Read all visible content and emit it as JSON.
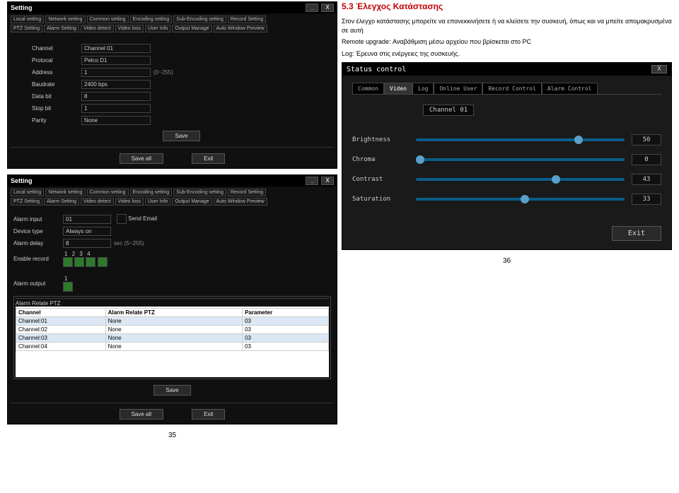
{
  "left": {
    "win1": {
      "title": "Setting",
      "tabs_row1": [
        "Local setting",
        "Network setting",
        "Common setting",
        "Encoding setting",
        "Sub-Encoding setting",
        "Record Setting"
      ],
      "tabs_row2": [
        "PTZ Setting",
        "Alarm Setting",
        "Video detect",
        "Video loss",
        "User Info",
        "Output Manage",
        "Auto Window Preview"
      ],
      "rows": {
        "channel_l": "Channel",
        "channel_v": "Channel 01",
        "protocol_l": "Protocal",
        "protocol_v": "Pelco D1",
        "address_l": "Address",
        "address_v": "1",
        "address_h": "(0~255)",
        "baud_l": "Baudrate",
        "baud_v": "2400 bps",
        "databit_l": "Data bit",
        "databit_v": "8",
        "stopbit_l": "Stop bit",
        "stopbit_v": "1",
        "parity_l": "Parity",
        "parity_v": "None"
      },
      "save": "Save",
      "saveall": "Save all",
      "exit": "Exit"
    },
    "win2": {
      "title": "Setting",
      "tabs_row1": [
        "Local setting",
        "Network setting",
        "Common setting",
        "Encoding setting",
        "Sub-Encoding setting",
        "Record Setting"
      ],
      "tabs_row2": [
        "PTZ Setting",
        "Alarm Setting",
        "Video detect",
        "Video loss",
        "User Info",
        "Output Manage",
        "Auto Window Preview"
      ],
      "alarm_input_l": "Alarm input",
      "alarm_input_v": "01",
      "sendemail": "Send Email",
      "device_type_l": "Device type",
      "device_type_v": "Always on",
      "alarm_delay_l": "Alarm delay",
      "alarm_delay_v": "8",
      "alarm_delay_h": "sec (5~255)",
      "enable_rec_l": "Enable record",
      "squares": [
        "1",
        "2",
        "3",
        "4"
      ],
      "alarm_output_l": "Alarm output",
      "alarm_output_sq": "1",
      "relate_label": "Alarm Relate PTZ",
      "thead": [
        "Channel",
        "Alarm Relate PTZ",
        "Parameter"
      ],
      "trow1": [
        "Channel:01",
        "None",
        "03"
      ],
      "trow2": [
        "Channel:02",
        "None",
        "03"
      ],
      "trow3": [
        "Channel:03",
        "None",
        "03"
      ],
      "trow4": [
        "Channel:04",
        "None",
        "03"
      ],
      "save": "Save",
      "saveall": "Save all",
      "exit": "Exit"
    },
    "page": "35"
  },
  "right": {
    "heading": "5.3 Έλεγχος Κατάστασης",
    "p1": "Στον έλεγχο κατάστασης μπορείτε να επανεκκινήσετε ή να κλείσετε την συσκευή, όπως και να μπείτε απομακρυσμένα σε αυτή",
    "p2": "Remote upgrade: Αναβάθμιση μέσω αρχείου που βρίσκεται στο PC",
    "p3": "Log: Έρευνα στις ενέργειες της συσκευής.",
    "status": {
      "title": "Status control",
      "close": "X",
      "tabs": [
        "Common",
        "Video",
        "Log",
        "Online User",
        "Record Control",
        "Alarm Control"
      ],
      "active": 1,
      "channel": "Channel 01",
      "sliders": [
        {
          "label": "Brightness",
          "val": "50",
          "pct": 76
        },
        {
          "label": "Chroma",
          "val": "0",
          "pct": 0
        },
        {
          "label": "Contrast",
          "val": "43",
          "pct": 65
        },
        {
          "label": "Saturation",
          "val": "33",
          "pct": 50
        }
      ],
      "exit": "Exit"
    },
    "page": "36"
  }
}
